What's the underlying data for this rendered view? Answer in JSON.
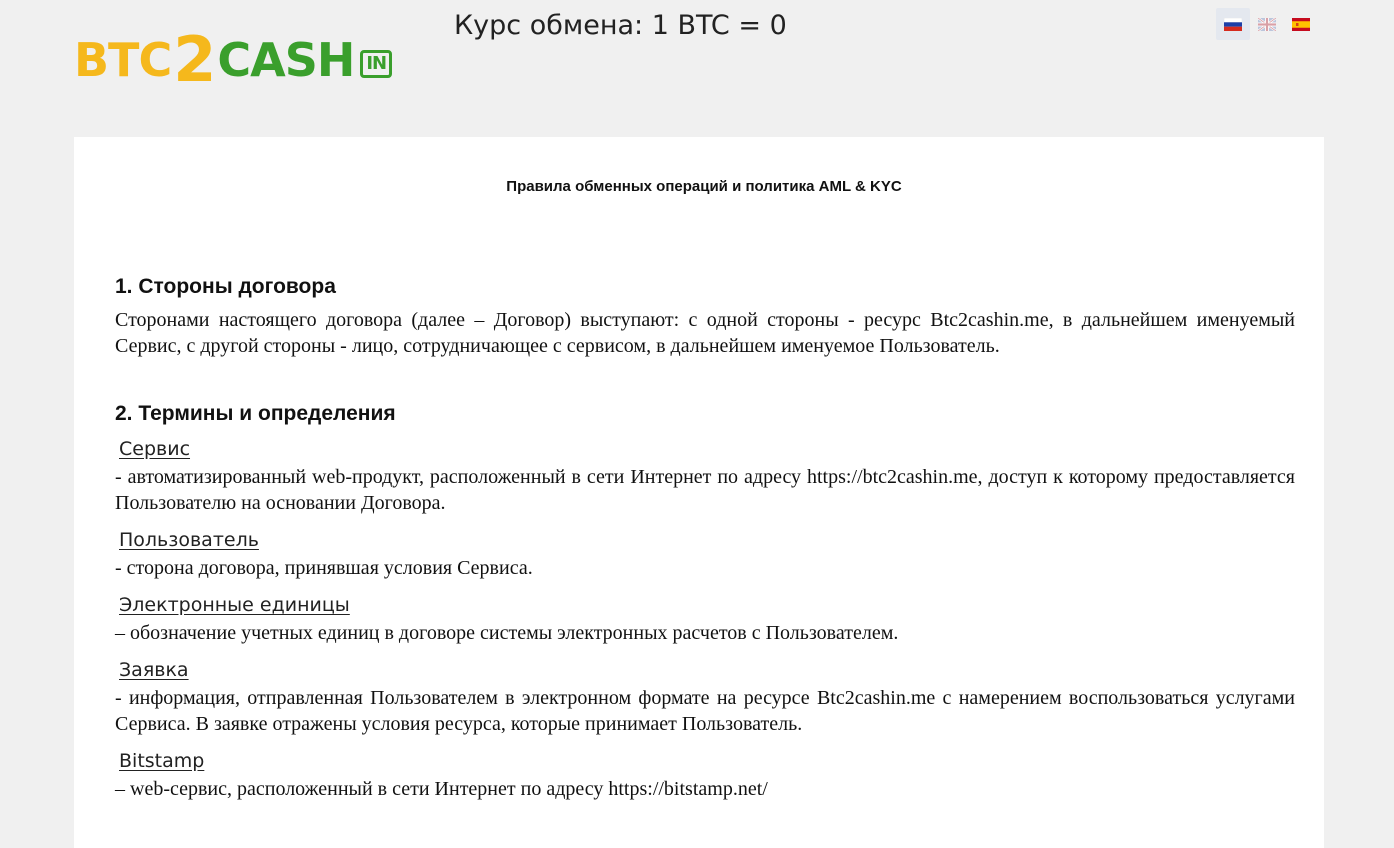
{
  "header": {
    "logo": {
      "part1": "BTC",
      "part2": "2",
      "part3": "CASH",
      "part4": "IN"
    },
    "rate_text": "Курс обмена: 1 BTC = 0",
    "languages": [
      {
        "code": "ru",
        "icon": "russia-flag-icon",
        "active": true
      },
      {
        "code": "en",
        "icon": "uk-flag-icon",
        "active": false
      },
      {
        "code": "es",
        "icon": "spain-flag-icon",
        "active": false
      }
    ]
  },
  "colors": {
    "logo_yellow": "#f5b81c",
    "logo_green": "#3a9f2c",
    "background": "#f0f0f0"
  },
  "page": {
    "title": "Правила обменных операций и политика AML & KYC",
    "sections": [
      {
        "heading": "1. Стороны договора",
        "text": "Сторонами настоящего договора (далее – Договор) выступают: с одной стороны - ресурс Btc2cashin.me, в дальнейшем именуемый Сервис, с другой стороны - лицо, сотрудничающее с сервисом, в дальнейшем именуемое Пользователь."
      },
      {
        "heading": "2. Термины и определения",
        "terms": [
          {
            "term": "Сервис",
            "definition": "- автоматизированный web-продукт, расположенный в сети Интернет по адресу https://btc2cashin.me, доступ к которому предоставляется Пользователю на основании Договора."
          },
          {
            "term": "Пользователь",
            "definition": "- сторона договора, принявшая условия Сервиса."
          },
          {
            "term": "Электронные единицы",
            "definition": "– обозначение учетных единиц в договоре системы электронных расчетов с Пользователем."
          },
          {
            "term": "Заявка",
            "definition": "- информация, отправленная Пользователем в электронном формате на ресурсе Btc2cashin.me с намерением воспользоваться услугами Сервиса. В заявке отражены условия ресурса, которые принимает Пользователь."
          },
          {
            "term": "Bitstamp",
            "definition": "– web-сервис, расположенный в сети Интернет по адресу https://bitstamp.net/"
          }
        ]
      }
    ]
  }
}
